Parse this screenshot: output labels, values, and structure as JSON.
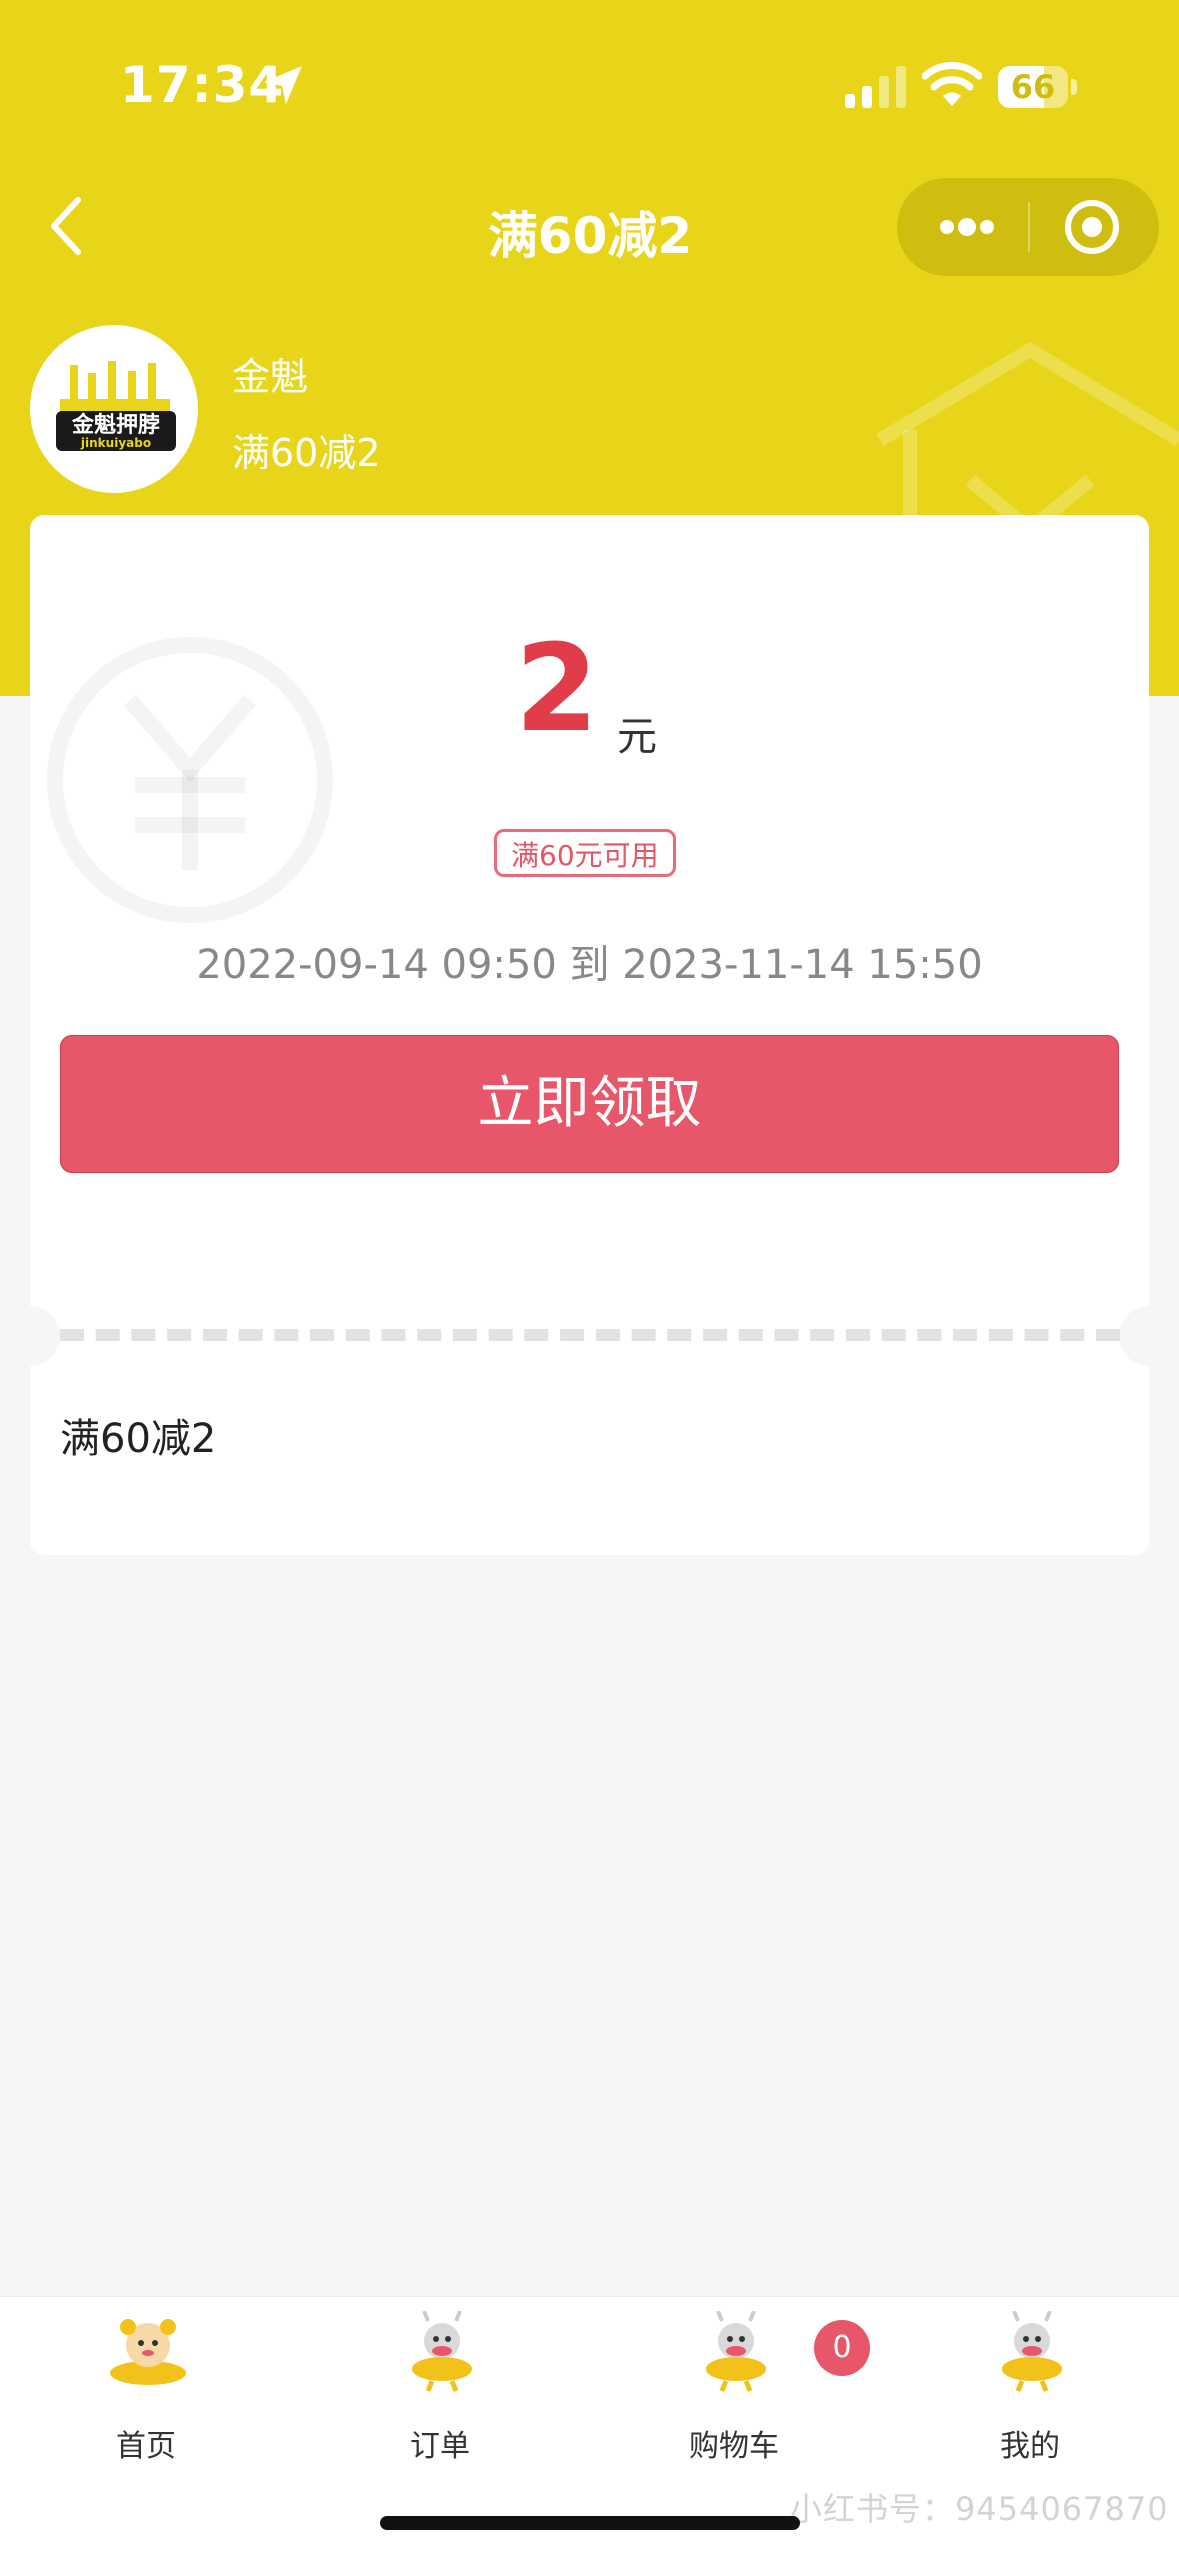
{
  "status_bar": {
    "time": "17:34",
    "battery": "66",
    "battery_level": 0.66
  },
  "nav": {
    "title": "满60减2"
  },
  "shop": {
    "name": "金魁",
    "subtitle": "满60减2",
    "logo_text": "金魁押脖",
    "logo_subtext": "jinkuiyabo"
  },
  "coupon": {
    "amount": "2",
    "unit": "元",
    "condition": "满60元可用",
    "validity": "2022-09-14 09:50 到 2023-11-14 15:50",
    "claim_label": "立即领取",
    "description": "满60减2"
  },
  "tabbar": {
    "items": [
      {
        "label": "首页"
      },
      {
        "label": "订单"
      },
      {
        "label": "购物车"
      },
      {
        "label": "我的"
      }
    ],
    "cart_count": "0"
  },
  "watermark": "小红书号：9454067870",
  "colors": {
    "brand_yellow": "#e8d51a",
    "accent_red": "#e8566a",
    "amount_red": "#e03c4a"
  }
}
